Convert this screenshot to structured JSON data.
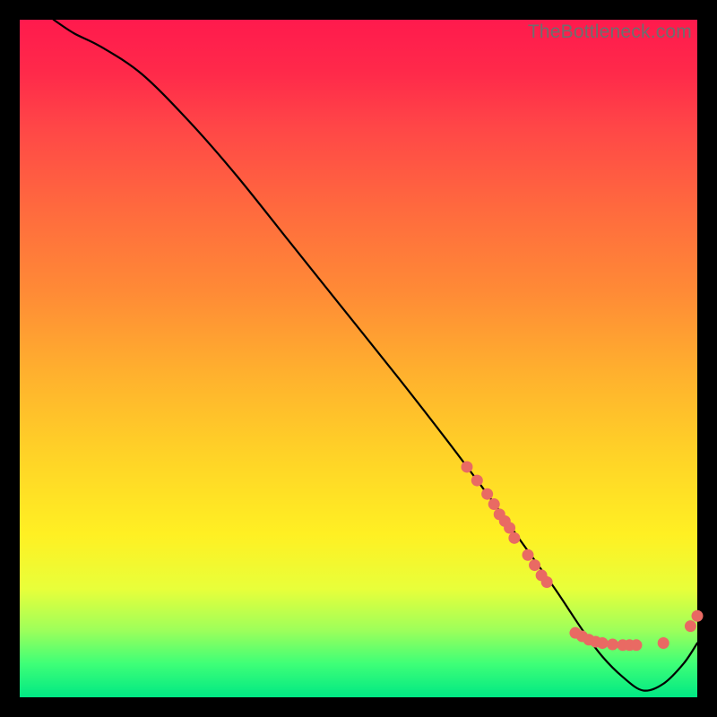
{
  "watermark": "TheBottleneck.com",
  "chart_data": {
    "type": "line",
    "title": "",
    "xlabel": "",
    "ylabel": "",
    "xlim": [
      0,
      100
    ],
    "ylim": [
      0,
      100
    ],
    "grid": false,
    "legend": false,
    "series": [
      {
        "name": "curve",
        "x": [
          5,
          8,
          12,
          18,
          25,
          32,
          40,
          48,
          56,
          63,
          69,
          74,
          79,
          83,
          86,
          89,
          92,
          95,
          98,
          100
        ],
        "y": [
          100,
          98,
          96,
          92,
          85,
          77,
          67,
          57,
          47,
          38,
          30,
          23,
          16,
          10,
          6,
          3,
          1,
          2,
          5,
          8
        ]
      }
    ],
    "scatter": [
      {
        "name": "cluster-on-slope",
        "color": "#e96a63",
        "points": [
          {
            "x": 66,
            "y": 34
          },
          {
            "x": 67.5,
            "y": 32
          },
          {
            "x": 69,
            "y": 30
          },
          {
            "x": 70,
            "y": 28.5
          },
          {
            "x": 70.8,
            "y": 27
          },
          {
            "x": 71.6,
            "y": 26
          },
          {
            "x": 72.3,
            "y": 25
          },
          {
            "x": 73,
            "y": 23.5
          },
          {
            "x": 75,
            "y": 21
          },
          {
            "x": 76,
            "y": 19.5
          },
          {
            "x": 77,
            "y": 18
          },
          {
            "x": 77.8,
            "y": 17
          }
        ]
      },
      {
        "name": "cluster-valley",
        "color": "#e96a63",
        "points": [
          {
            "x": 82,
            "y": 9.5
          },
          {
            "x": 83,
            "y": 9
          },
          {
            "x": 84,
            "y": 8.5
          },
          {
            "x": 85,
            "y": 8.2
          },
          {
            "x": 86,
            "y": 8.0
          },
          {
            "x": 87.5,
            "y": 7.8
          },
          {
            "x": 89,
            "y": 7.7
          },
          {
            "x": 90,
            "y": 7.7
          },
          {
            "x": 91,
            "y": 7.7
          }
        ]
      },
      {
        "name": "cluster-right",
        "color": "#e96a63",
        "points": [
          {
            "x": 95,
            "y": 8.0
          },
          {
            "x": 99,
            "y": 10.5
          },
          {
            "x": 100,
            "y": 12
          }
        ]
      }
    ]
  }
}
